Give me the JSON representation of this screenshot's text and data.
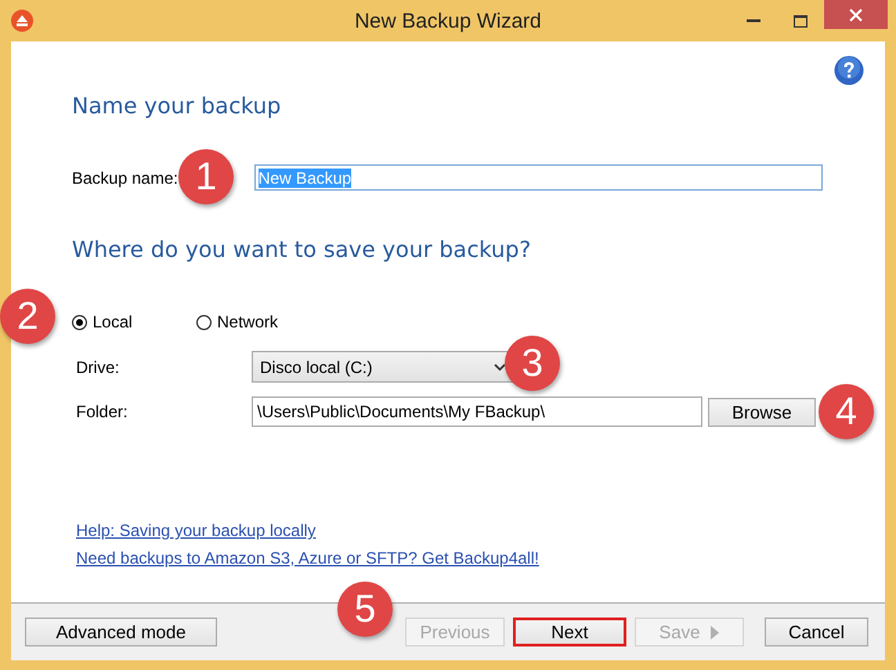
{
  "window": {
    "title": "New Backup Wizard"
  },
  "name_heading": "Name your backup",
  "backup_name": {
    "label": "Backup name:",
    "value": "New Backup",
    "text_selected": true
  },
  "save_heading": "Where do you want to save your backup?",
  "location_options": [
    {
      "label": "Local",
      "selected": true
    },
    {
      "label": "Network",
      "selected": false
    }
  ],
  "drive": {
    "label": "Drive:",
    "value": "Disco local (C:)"
  },
  "folder": {
    "label": "Folder:",
    "value": "\\Users\\Public\\Documents\\My FBackup\\",
    "button": "Browse"
  },
  "links": [
    "Help: Saving your backup locally",
    "Need backups to Amazon S3, Azure or SFTP? Get Backup4all!"
  ],
  "buttons": [
    {
      "label": "Advanced mode",
      "disabled": false,
      "highlighted": false,
      "menu_arrow": false
    },
    {
      "label": "Previous",
      "disabled": true,
      "highlighted": false,
      "menu_arrow": false
    },
    {
      "label": "Next",
      "disabled": false,
      "highlighted": true,
      "menu_arrow": false
    },
    {
      "label": "Save",
      "disabled": true,
      "highlighted": false,
      "menu_arrow": true
    },
    {
      "label": "Cancel",
      "disabled": false,
      "highlighted": false,
      "menu_arrow": false
    }
  ],
  "callouts": [
    {
      "number": "1"
    },
    {
      "number": "2"
    },
    {
      "number": "3"
    },
    {
      "number": "4"
    },
    {
      "number": "5"
    }
  ]
}
